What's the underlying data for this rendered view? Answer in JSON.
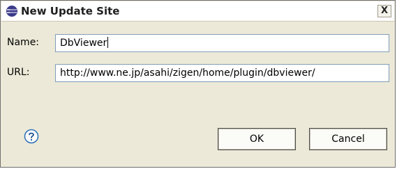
{
  "dialog": {
    "title": "New Update Site",
    "close_glyph": "X"
  },
  "form": {
    "name_label": "Name:",
    "name_value": "DbViewer",
    "url_label": "URL:",
    "url_value": "http://www.ne.jp/asahi/zigen/home/plugin/dbviewer/"
  },
  "buttons": {
    "ok_label": "OK",
    "cancel_label": "Cancel"
  },
  "icons": {
    "title_icon": "eclipse-icon",
    "help_icon": "help-icon",
    "close_icon": "close-icon"
  },
  "colors": {
    "dialog_background": "#ece9d8",
    "field_border": "#7f9db9",
    "help_accent": "#2a6fb7"
  }
}
